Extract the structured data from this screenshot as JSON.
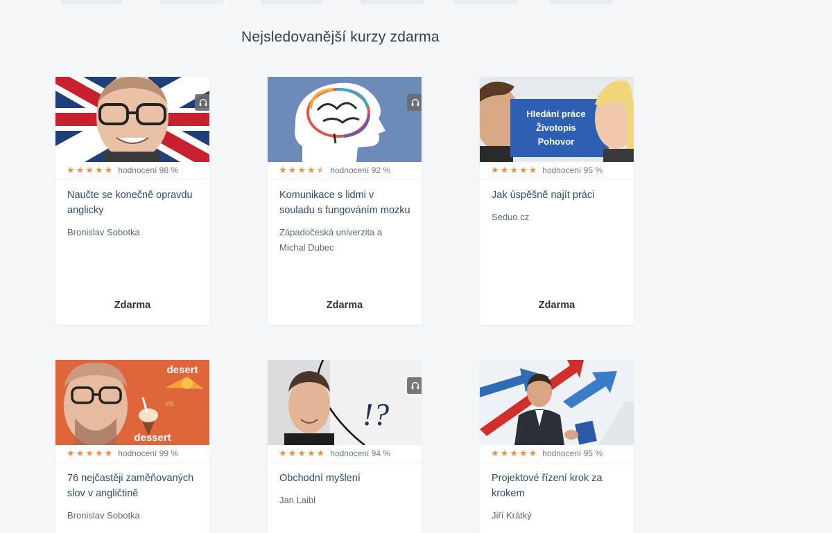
{
  "section_title": "Nejsledovanější kurzy zdarma",
  "courses": [
    {
      "title": "Naučte se konečně opravdu anglicky",
      "author": "Bronislav Sobotka",
      "rating_text": "hodnocení 98 %",
      "stars": 5,
      "price": "Zdarma",
      "has_audio": true,
      "thumb_text": []
    },
    {
      "title": "Komunikace s lidmi v souladu s fungováním mozku",
      "author": "Západočeská univerzita a Michal Dubec",
      "rating_text": "hodnocení 92 %",
      "stars": 4.5,
      "price": "Zdarma",
      "has_audio": true,
      "thumb_text": []
    },
    {
      "title": "Jak úspěšně najít práci",
      "author": "Seduo.cz",
      "rating_text": "hodnocení 95 %",
      "stars": 5,
      "price": "Zdarma",
      "has_audio": false,
      "thumb_text": [
        "Hledání práce",
        "Životopis",
        "Pohovor"
      ]
    },
    {
      "title": "76 nejčastěji zaměňovaných slov v angličtině",
      "author": "Bronislav Sobotka",
      "rating_text": "hodnocení 99 %",
      "stars": 5,
      "price": "",
      "has_audio": false,
      "thumb_text": [
        "desert",
        "vs.",
        "dessert"
      ]
    },
    {
      "title": "Obchodní myšlení",
      "author": "Jan Laibl",
      "rating_text": "hodnocení 94 %",
      "stars": 5,
      "price": "",
      "has_audio": true,
      "thumb_text": [
        "!?"
      ]
    },
    {
      "title": "Projektové řízení krok za krokem",
      "author": "Jiří Krátký",
      "rating_text": "hodnocení 95 %",
      "stars": 5,
      "price": "",
      "has_audio": false,
      "thumb_text": []
    }
  ],
  "colors": {
    "star": "#e8914a",
    "title": "#2e4a66",
    "background": "#f4f6f7"
  },
  "icons": {
    "audio": "headphones-icon",
    "star": "star-icon"
  }
}
